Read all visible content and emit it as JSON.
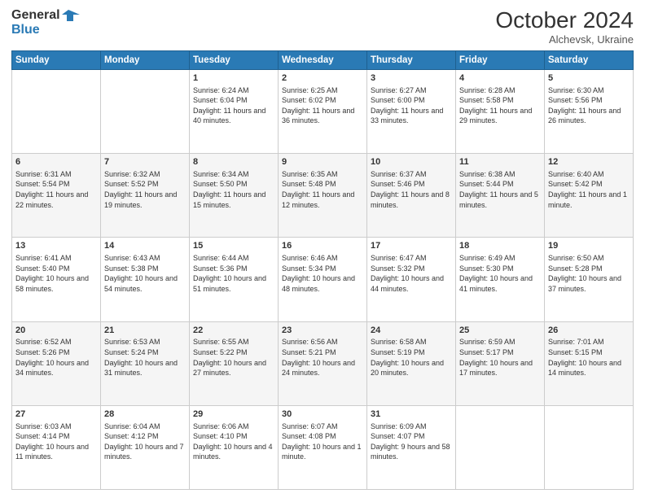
{
  "logo": {
    "line1": "General",
    "line2": "Blue"
  },
  "title": "October 2024",
  "subtitle": "Alchevsk, Ukraine",
  "days_header": [
    "Sunday",
    "Monday",
    "Tuesday",
    "Wednesday",
    "Thursday",
    "Friday",
    "Saturday"
  ],
  "weeks": [
    [
      {
        "day": "",
        "content": ""
      },
      {
        "day": "",
        "content": ""
      },
      {
        "day": "1",
        "content": "Sunrise: 6:24 AM\nSunset: 6:04 PM\nDaylight: 11 hours and 40 minutes."
      },
      {
        "day": "2",
        "content": "Sunrise: 6:25 AM\nSunset: 6:02 PM\nDaylight: 11 hours and 36 minutes."
      },
      {
        "day": "3",
        "content": "Sunrise: 6:27 AM\nSunset: 6:00 PM\nDaylight: 11 hours and 33 minutes."
      },
      {
        "day": "4",
        "content": "Sunrise: 6:28 AM\nSunset: 5:58 PM\nDaylight: 11 hours and 29 minutes."
      },
      {
        "day": "5",
        "content": "Sunrise: 6:30 AM\nSunset: 5:56 PM\nDaylight: 11 hours and 26 minutes."
      }
    ],
    [
      {
        "day": "6",
        "content": "Sunrise: 6:31 AM\nSunset: 5:54 PM\nDaylight: 11 hours and 22 minutes."
      },
      {
        "day": "7",
        "content": "Sunrise: 6:32 AM\nSunset: 5:52 PM\nDaylight: 11 hours and 19 minutes."
      },
      {
        "day": "8",
        "content": "Sunrise: 6:34 AM\nSunset: 5:50 PM\nDaylight: 11 hours and 15 minutes."
      },
      {
        "day": "9",
        "content": "Sunrise: 6:35 AM\nSunset: 5:48 PM\nDaylight: 11 hours and 12 minutes."
      },
      {
        "day": "10",
        "content": "Sunrise: 6:37 AM\nSunset: 5:46 PM\nDaylight: 11 hours and 8 minutes."
      },
      {
        "day": "11",
        "content": "Sunrise: 6:38 AM\nSunset: 5:44 PM\nDaylight: 11 hours and 5 minutes."
      },
      {
        "day": "12",
        "content": "Sunrise: 6:40 AM\nSunset: 5:42 PM\nDaylight: 11 hours and 1 minute."
      }
    ],
    [
      {
        "day": "13",
        "content": "Sunrise: 6:41 AM\nSunset: 5:40 PM\nDaylight: 10 hours and 58 minutes."
      },
      {
        "day": "14",
        "content": "Sunrise: 6:43 AM\nSunset: 5:38 PM\nDaylight: 10 hours and 54 minutes."
      },
      {
        "day": "15",
        "content": "Sunrise: 6:44 AM\nSunset: 5:36 PM\nDaylight: 10 hours and 51 minutes."
      },
      {
        "day": "16",
        "content": "Sunrise: 6:46 AM\nSunset: 5:34 PM\nDaylight: 10 hours and 48 minutes."
      },
      {
        "day": "17",
        "content": "Sunrise: 6:47 AM\nSunset: 5:32 PM\nDaylight: 10 hours and 44 minutes."
      },
      {
        "day": "18",
        "content": "Sunrise: 6:49 AM\nSunset: 5:30 PM\nDaylight: 10 hours and 41 minutes."
      },
      {
        "day": "19",
        "content": "Sunrise: 6:50 AM\nSunset: 5:28 PM\nDaylight: 10 hours and 37 minutes."
      }
    ],
    [
      {
        "day": "20",
        "content": "Sunrise: 6:52 AM\nSunset: 5:26 PM\nDaylight: 10 hours and 34 minutes."
      },
      {
        "day": "21",
        "content": "Sunrise: 6:53 AM\nSunset: 5:24 PM\nDaylight: 10 hours and 31 minutes."
      },
      {
        "day": "22",
        "content": "Sunrise: 6:55 AM\nSunset: 5:22 PM\nDaylight: 10 hours and 27 minutes."
      },
      {
        "day": "23",
        "content": "Sunrise: 6:56 AM\nSunset: 5:21 PM\nDaylight: 10 hours and 24 minutes."
      },
      {
        "day": "24",
        "content": "Sunrise: 6:58 AM\nSunset: 5:19 PM\nDaylight: 10 hours and 20 minutes."
      },
      {
        "day": "25",
        "content": "Sunrise: 6:59 AM\nSunset: 5:17 PM\nDaylight: 10 hours and 17 minutes."
      },
      {
        "day": "26",
        "content": "Sunrise: 7:01 AM\nSunset: 5:15 PM\nDaylight: 10 hours and 14 minutes."
      }
    ],
    [
      {
        "day": "27",
        "content": "Sunrise: 6:03 AM\nSunset: 4:14 PM\nDaylight: 10 hours and 11 minutes."
      },
      {
        "day": "28",
        "content": "Sunrise: 6:04 AM\nSunset: 4:12 PM\nDaylight: 10 hours and 7 minutes."
      },
      {
        "day": "29",
        "content": "Sunrise: 6:06 AM\nSunset: 4:10 PM\nDaylight: 10 hours and 4 minutes."
      },
      {
        "day": "30",
        "content": "Sunrise: 6:07 AM\nSunset: 4:08 PM\nDaylight: 10 hours and 1 minute."
      },
      {
        "day": "31",
        "content": "Sunrise: 6:09 AM\nSunset: 4:07 PM\nDaylight: 9 hours and 58 minutes."
      },
      {
        "day": "",
        "content": ""
      },
      {
        "day": "",
        "content": ""
      }
    ]
  ]
}
